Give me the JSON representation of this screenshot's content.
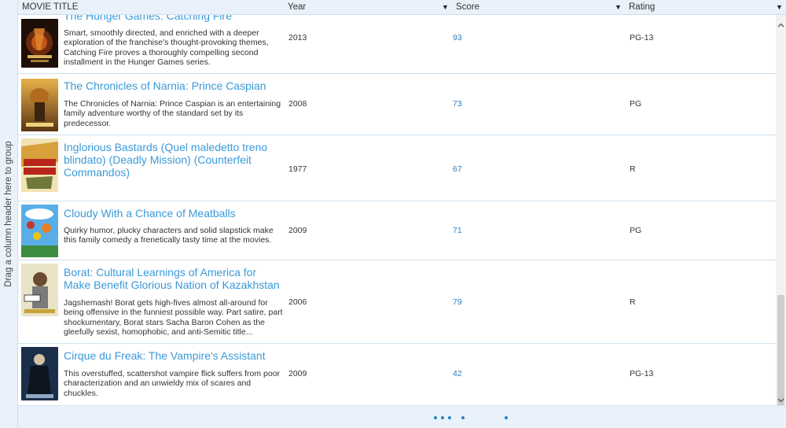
{
  "group_panel": {
    "text": "Drag a column header here to group"
  },
  "header": {
    "movie_title": "MOVIE TITLE",
    "year": "Year",
    "score": "Score",
    "rating": "Rating",
    "filter_icon": "▼"
  },
  "rows": [
    {
      "title": "The Hunger Games: Catching Fire",
      "desc": "Smart, smoothly directed, and enriched with a deeper exploration of the franchise's thought-provoking themes, Catching Fire proves a thoroughly compelling second installment in the Hunger Games series.",
      "year": "2013",
      "score": "93",
      "rating": "PG-13"
    },
    {
      "title": "The Chronicles of Narnia: Prince Caspian",
      "desc": "The Chronicles of Narnia: Prince Caspian is an entertaining family adventure worthy of the standard set by its predecessor.",
      "year": "2008",
      "score": "73",
      "rating": "PG"
    },
    {
      "title": "Inglorious Bastards (Quel maledetto treno blindato) (Deadly Mission) (Counterfeit Commandos)",
      "desc": "",
      "year": "1977",
      "score": "67",
      "rating": "R"
    },
    {
      "title": "Cloudy With a Chance of Meatballs",
      "desc": "Quirky humor, plucky characters and solid slapstick make this family comedy a frenetically tasty time at the movies.",
      "year": "2009",
      "score": "71",
      "rating": "PG"
    },
    {
      "title": "Borat: Cultural Learnings of America for Make Benefit Glorious Nation of Kazakhstan",
      "desc": "Jagshemash! Borat gets high-fives almost all-around for being offensive in the funniest possible way. Part satire, part shockumentary, Borat stars Sacha Baron Cohen as the gleefully sexist, homophobic, and anti-Semitic title...",
      "year": "2006",
      "score": "79",
      "rating": "R"
    },
    {
      "title": "Cirque du Freak: The Vampire's Assistant",
      "desc": "This overstuffed, scattershot vampire flick suffers from poor characterization and an unwieldy mix of scares and chuckles.",
      "year": "2009",
      "score": "42",
      "rating": "PG-13"
    }
  ],
  "scrollbar": {
    "up_icon": "chevron-up-icon",
    "down_icon": "chevron-down-icon"
  },
  "footer": {
    "indicator_icon": "loading-dots-icon"
  }
}
